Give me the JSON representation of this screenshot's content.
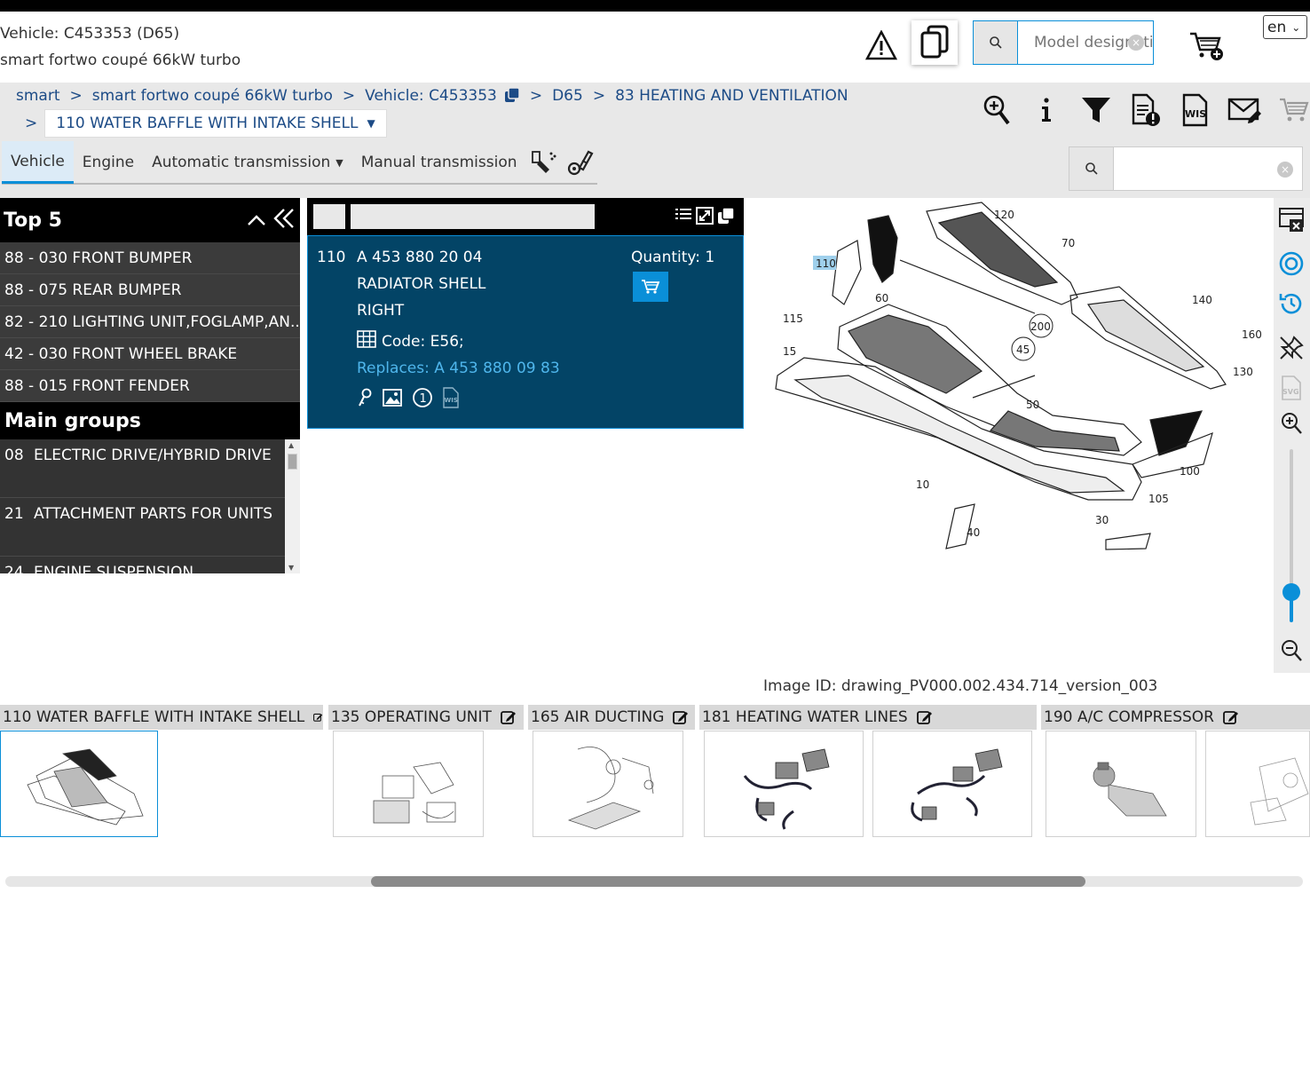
{
  "header": {
    "vehicle_line": "Vehicle: C453353 (D65)",
    "model_line": "smart fortwo coupé 66kW turbo",
    "model_search_placeholder": "Model designation",
    "language": "en"
  },
  "breadcrumb": {
    "items": [
      "smart",
      "smart fortwo coupé 66kW turbo",
      "Vehicle: C453353",
      "D65",
      "83 HEATING AND VENTILATION"
    ],
    "separator": ">",
    "current": "110 WATER BAFFLE WITH INTAKE SHELL"
  },
  "tabs": [
    {
      "label": "Vehicle",
      "active": true
    },
    {
      "label": "Engine",
      "active": false
    },
    {
      "label": "Automatic transmission",
      "active": false
    },
    {
      "label": "Manual transmission",
      "active": false
    }
  ],
  "top5": {
    "title": "Top 5",
    "items": [
      "88 - 030 FRONT BUMPER",
      "88 - 075 REAR BUMPER",
      "82 - 210 LIGHTING UNIT,FOGLAMP,AN...",
      "42 - 030 FRONT WHEEL BRAKE",
      "88 - 015 FRONT FENDER"
    ]
  },
  "main_groups": {
    "title": "Main groups",
    "items": [
      {
        "num": "08",
        "label": "ELECTRIC DRIVE/HYBRID DRIVE"
      },
      {
        "num": "21",
        "label": "ATTACHMENT PARTS FOR UNITS"
      },
      {
        "num": "24",
        "label": "ENGINE SUSPENSION"
      }
    ]
  },
  "part_detail": {
    "position": "110",
    "part_number": "A 453 880 20 04",
    "quantity": "Quantity: 1",
    "desc1": "RADIATOR SHELL",
    "desc2": "RIGHT",
    "code": "Code: E56;",
    "replaces": "Replaces: A 453 880 09 83"
  },
  "drawing": {
    "image_id": "Image ID: drawing_PV000.002.434.714_version_003",
    "callouts": [
      "120",
      "70",
      "110",
      "60",
      "140",
      "115",
      "200",
      "160",
      "45",
      "15",
      "130",
      "50",
      "100",
      "10",
      "105",
      "30",
      "40"
    ],
    "highlighted": "110"
  },
  "zoom_level": 0.15,
  "sheets": [
    "110 WATER BAFFLE WITH INTAKE SHELL",
    "135 OPERATING UNIT",
    "165 AIR DUCTING",
    "181 HEATING WATER LINES",
    "190 A/C COMPRESSOR"
  ],
  "colors": {
    "accent": "#0a8fd8",
    "link": "#1c4b86",
    "detail_bg": "#034466",
    "panel_dark": "#333333"
  }
}
